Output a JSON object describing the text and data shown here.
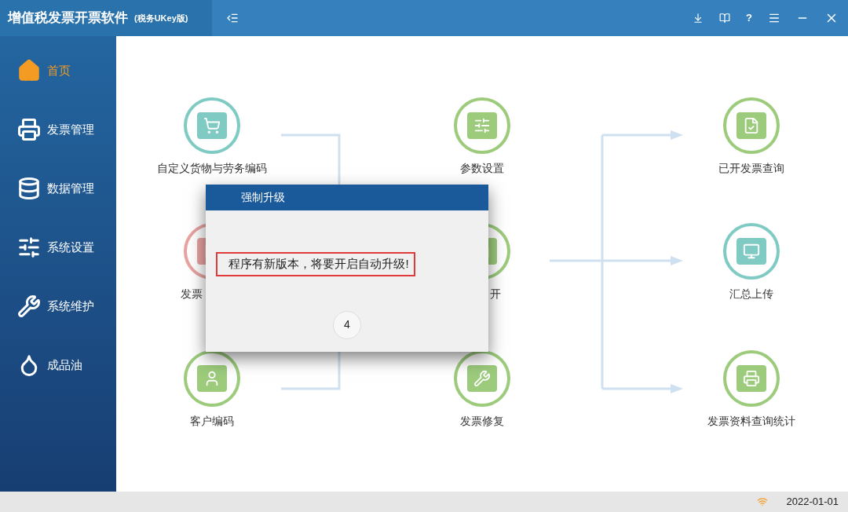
{
  "window": {
    "title": "增值税发票开票软件",
    "edition": "(税务UKey版)",
    "help": "?"
  },
  "sidebar": {
    "items": [
      {
        "label": "首页",
        "selected": true
      },
      {
        "label": "发票管理",
        "selected": false
      },
      {
        "label": "数据管理",
        "selected": false
      },
      {
        "label": "系统设置",
        "selected": false
      },
      {
        "label": "系统维护",
        "selected": false
      },
      {
        "label": "成品油",
        "selected": false
      }
    ]
  },
  "nodes": [
    {
      "label": "自定义货物与劳务编码",
      "color": "#7fcbc4"
    },
    {
      "label": "参数设置",
      "color": "#9ccb7c"
    },
    {
      "label": "已开发票查询",
      "color": "#9ccb7c"
    },
    {
      "label": "发票",
      "color": "#e8a3a0"
    },
    {
      "label": "开",
      "color": "#9ccb7c"
    },
    {
      "label": "汇总上传",
      "color": "#7fcbc4"
    },
    {
      "label": "客户编码",
      "color": "#9ccb7c"
    },
    {
      "label": "发票修复",
      "color": "#9ccb7c"
    },
    {
      "label": "发票资料查询统计",
      "color": "#9ccb7c"
    }
  ],
  "dialog": {
    "title": "强制升级",
    "message": "程序有新版本，将要开启自动升级!",
    "countdown": "4"
  },
  "status_bar": {
    "date": "2022-01-01"
  }
}
